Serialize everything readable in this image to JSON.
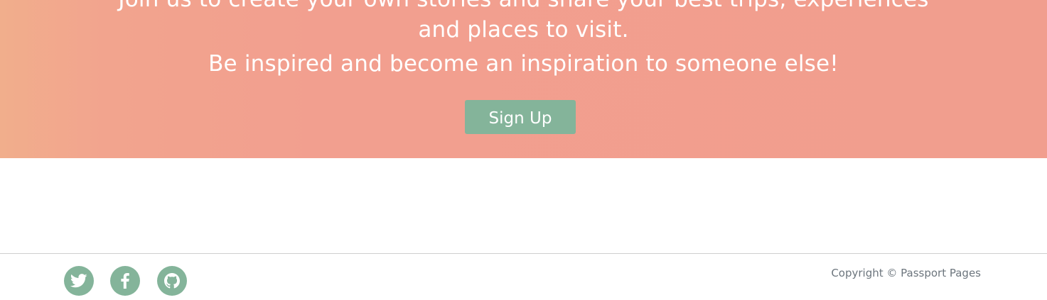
{
  "hero": {
    "line1": "Join us to create your own stories and share your best trips, experiences",
    "line2": "and places to visit.",
    "line3": "Be inspired and become an inspiration to someone else!",
    "signup_label": "Sign Up"
  },
  "footer": {
    "social": [
      {
        "icon": "twitter-icon"
      },
      {
        "icon": "facebook-icon"
      },
      {
        "icon": "github-icon"
      }
    ],
    "copyright": "Copyright © Passport Pages"
  },
  "colors": {
    "accent": "#84b49a",
    "hero_gradient_start": "#f1ae8c",
    "hero_gradient_end": "#f19e8e",
    "text_muted": "#6c757d"
  }
}
